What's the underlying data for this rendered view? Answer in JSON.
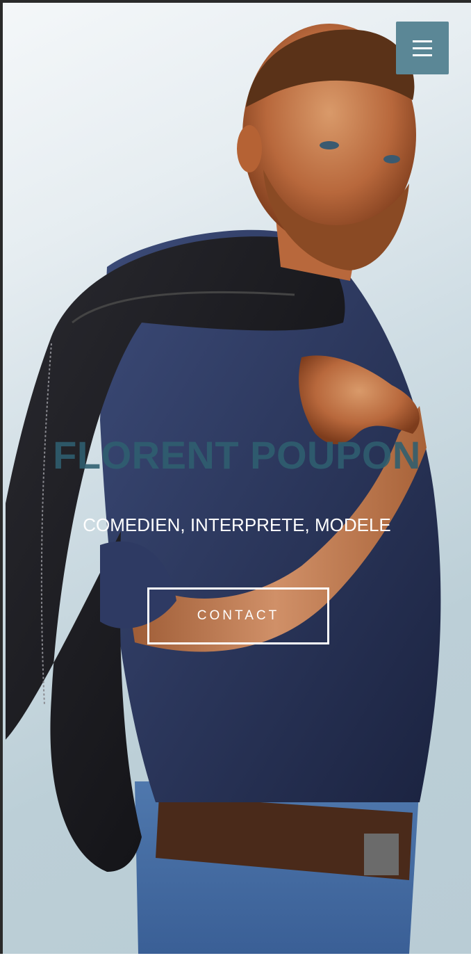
{
  "hero": {
    "title": "FLORENT POUPON",
    "subtitle": "COMEDIEN, INTERPRETE, MODELE",
    "contact_label": "CONTACT",
    "background_image": "portrait of man with leather jacket over shoulder"
  },
  "navigation": {
    "menu_icon": "hamburger-menu-icon"
  },
  "colors": {
    "accent": "#5b8796",
    "title": "#2f5f70",
    "background_light": "#eef3f6",
    "background_blue": "#bccfd7"
  }
}
